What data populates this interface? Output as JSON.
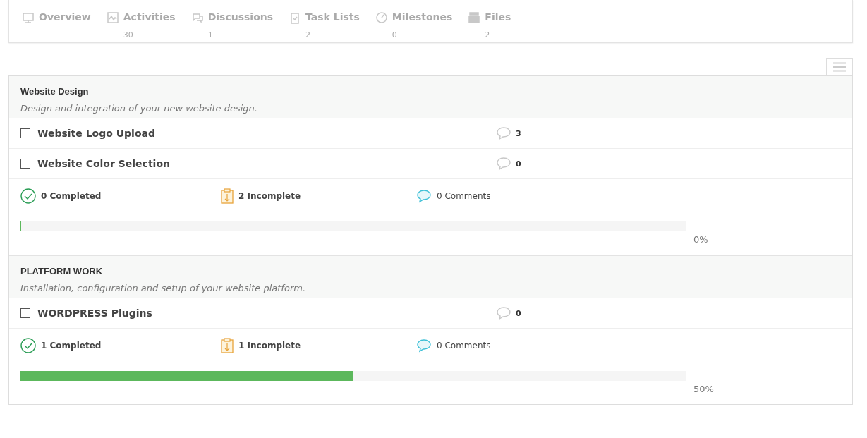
{
  "nav_tabs": [
    {
      "kind": "overview",
      "label": "Overview"
    },
    {
      "kind": "activities",
      "label": "Activities",
      "count": "30"
    },
    {
      "kind": "discussions",
      "label": "Discussions",
      "count": "1"
    },
    {
      "kind": "tasklists",
      "label": "Task Lists",
      "count": "2"
    },
    {
      "kind": "milestones",
      "label": "Milestones",
      "count": "0"
    },
    {
      "kind": "files",
      "label": "Files",
      "count": "2"
    }
  ],
  "task_lists": [
    {
      "title": "Website Design",
      "description": "Design and integration of your new website design.",
      "tasks": [
        {
          "name": "Website Logo Upload",
          "checked": false,
          "comments": "3"
        },
        {
          "name": "Website Color Selection",
          "checked": false,
          "comments": "0"
        }
      ],
      "completed": "0 Completed",
      "incomplete": "2 Incomplete",
      "comments": "0 Comments",
      "level": 0,
      "percent": "0%"
    },
    {
      "title": "PLATFORM WORK",
      "description": "Installation, configuration and setup of your website platform.",
      "tasks": [
        {
          "name": "WORDPRESS Plugins",
          "checked": false,
          "comments": "0"
        }
      ],
      "completed": "1 Completed",
      "incomplete": "1 Incomplete",
      "comments": "0 Comments",
      "level": 0.5,
      "percent": "50%"
    }
  ]
}
